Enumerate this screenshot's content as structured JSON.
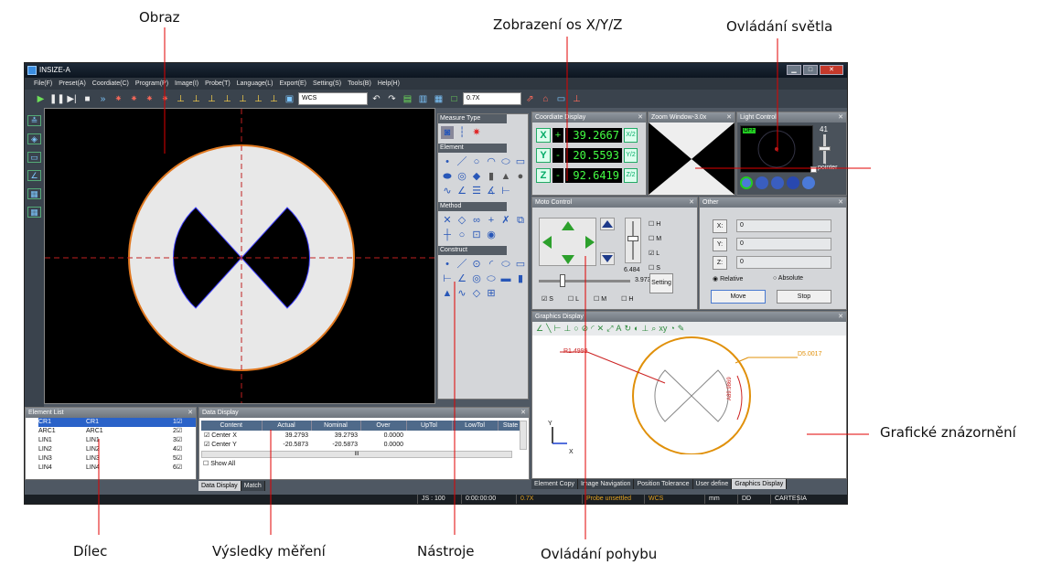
{
  "callouts": {
    "obraz": "Obraz",
    "osy": "Zobrazení os X/Y/Z",
    "svetlo": "Ovládání světla",
    "graficke": "Grafické znázornění",
    "dilec": "Dílec",
    "vysledky": "Výsledky měření",
    "nastroje": "Nástroje",
    "pohyb": "Ovládání pohybu"
  },
  "window": {
    "title": "INSIZE-A"
  },
  "menu": [
    "File(F)",
    "Preset(A)",
    "Coordiate(C)",
    "Program(P)",
    "Image(I)",
    "Probe(T)",
    "Language(L)",
    "Export(E)",
    "Setting(S)",
    "Tools(B)",
    "Help(H)"
  ],
  "toolbar": {
    "coord_system": "WCS",
    "zoom": "0.7X"
  },
  "measure": {
    "title": "Measure Type",
    "element": "Element",
    "method": "Method",
    "construct": "Construct"
  },
  "coord_display": {
    "title": "Coordiate Display",
    "x_sign": "+",
    "x_value": "39.2667",
    "y_sign": "-",
    "y_value": "20.5593",
    "z_sign": "-",
    "z_value": "92.6419"
  },
  "zoom_window": {
    "title": "Zoom Window-3.0x"
  },
  "light": {
    "title": "Light Control",
    "value": "41",
    "off": "OFF",
    "pointer_label": "pointer"
  },
  "moto": {
    "title": "Moto Control",
    "value1": "6.484",
    "value2": "3.973",
    "setting": "Setting",
    "checks_right": [
      "H",
      "M",
      "L",
      "S"
    ],
    "checks_bottom": [
      "S",
      "L",
      "M",
      "H"
    ]
  },
  "other": {
    "title": "Other",
    "x_label": "X:",
    "x_val": "0",
    "y_label": "Y:",
    "y_val": "0",
    "z_label": "Z:",
    "z_val": "0",
    "relative": "Relative",
    "absolute": "Absolute",
    "move": "Move",
    "stop": "Stop"
  },
  "graphics": {
    "title": "Graphics Display",
    "r_label": "R1.4999",
    "d_label": "D5.0017",
    "a_label": "A89.9869",
    "tabs": [
      "Element Copy",
      "Image Navigation",
      "Position Tolerance",
      "User define",
      "Graphics Display"
    ]
  },
  "element_list": {
    "title": "Element List",
    "rows": [
      {
        "a": "CR1",
        "b": "CR1",
        "n": "1"
      },
      {
        "a": "ARC1",
        "b": "ARC1",
        "n": "2"
      },
      {
        "a": "LIN1",
        "b": "LIN1",
        "n": "3"
      },
      {
        "a": "LIN2",
        "b": "LIN2",
        "n": "4"
      },
      {
        "a": "LIN3",
        "b": "LIN3",
        "n": "5"
      },
      {
        "a": "LIN4",
        "b": "LIN4",
        "n": "6"
      }
    ]
  },
  "data_display": {
    "title": "Data Display",
    "headers": [
      "Content",
      "Actual",
      "Nominal",
      "Over",
      "UpTol",
      "LowTol",
      "State"
    ],
    "rows": [
      [
        "Center X",
        "39.2793",
        "39.2793",
        "0.0000",
        "",
        "",
        ""
      ],
      [
        "Center Y",
        "-20.5873",
        "-20.5873",
        "0.0000",
        "",
        "",
        ""
      ]
    ],
    "show_all": "Show All",
    "tabs": [
      "Data Display",
      "Match"
    ],
    "scroll_mark": "III"
  },
  "status": [
    "JS : 100",
    "0:00:00:00",
    "0.7X",
    "Probe unsettled",
    "WCS",
    "mm",
    "DD",
    "CARTESIA"
  ]
}
